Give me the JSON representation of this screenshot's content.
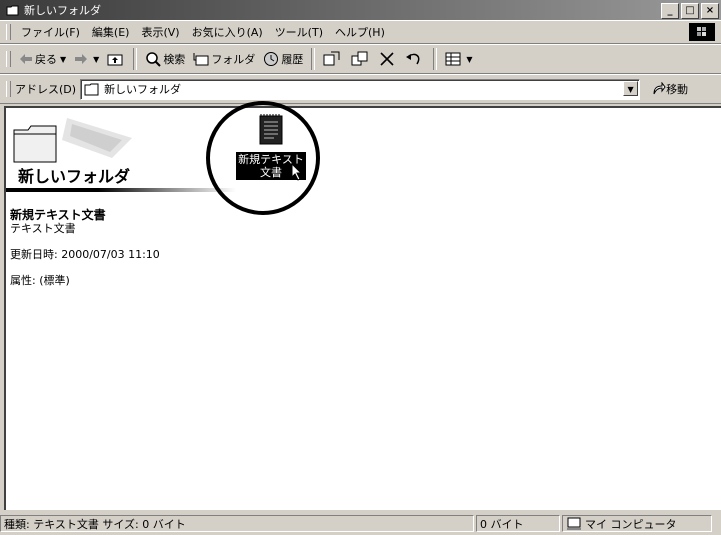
{
  "window": {
    "title": "新しいフォルダ",
    "caption_buttons": [
      "_",
      "□",
      "×"
    ]
  },
  "menu": [
    "ファイル(F)",
    "編集(E)",
    "表示(V)",
    "お気に入り(A)",
    "ツール(T)",
    "ヘルプ(H)"
  ],
  "toolbar": {
    "back": "戻る",
    "search": "検索",
    "folders": "フォルダ",
    "history": "履歴"
  },
  "address": {
    "label": "アドレス(D)",
    "value": "新しいフォルダ",
    "go": "移動"
  },
  "folder_panel": {
    "title": "新しいフォルダ",
    "selected_name": "新規テキスト文書",
    "selected_type": "テキスト文書",
    "modified": "更新日時: 2000/07/03 11:10",
    "attributes": "属性: (標準)"
  },
  "file_item": {
    "label_line1": "新規テキスト",
    "label_line2": "文書"
  },
  "statusbar": {
    "info": "種類: テキスト文書 サイズ: 0 バイト",
    "size": "0 バイト",
    "zone": "マイ コンピュータ"
  }
}
